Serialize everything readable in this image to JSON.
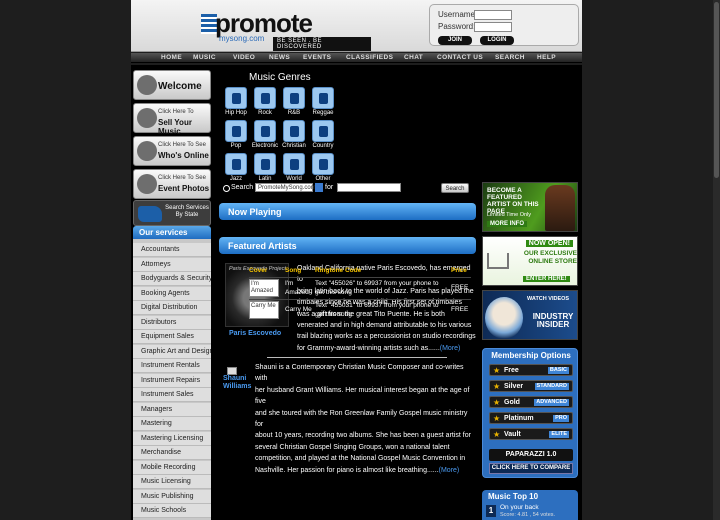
{
  "header": {
    "logo_word": "promote",
    "logo_sub": "mysong.com",
    "logo_tag": "BE SEEN . BE DISCOVERED",
    "username_label": "Username:",
    "password_label": "Password:",
    "join": "JOIN",
    "login": "LOGIN"
  },
  "nav": [
    "HOME",
    "MUSIC",
    "VIDEO",
    "NEWS",
    "EVENTS",
    "CLASSIFIEDS",
    "CHAT",
    "CONTACT US",
    "SEARCH",
    "HELP"
  ],
  "left": {
    "buttons": [
      {
        "t1": "",
        "t2": "Welcome"
      },
      {
        "t1": "Click Here To",
        "t2": "Sell Your Music"
      },
      {
        "t1": "Click Here To See",
        "t2": "Who's Online"
      },
      {
        "t1": "Click Here To See",
        "t2": "Event Photos"
      }
    ],
    "state_search": "Search Services By State",
    "services_title": "Our services",
    "services": [
      "Accountants",
      "Attorneys",
      "Bodyguards & Security",
      "Booking Agents",
      "Digital Distribution",
      "Distributors",
      "Equipment Sales",
      "Graphic Art and Design",
      "Instrument Rentals",
      "Instrument Repairs",
      "Instrument Sales",
      "Managers",
      "Mastering",
      "Mastering Licensing",
      "Merchandise",
      "Mobile Recording",
      "Music Licensing",
      "Music Publishing",
      "Music Schools"
    ]
  },
  "genres": {
    "title": "Music Genres",
    "items": [
      "Hip Hop",
      "Rock",
      "R&B",
      "Reggae",
      "Pop",
      "Electronic",
      "Christian",
      "Country",
      "Jazz",
      "Latin",
      "World",
      "Other"
    ]
  },
  "search": {
    "label": "Search",
    "select": "PromoteMySong.com",
    "for": "for",
    "button": "Search"
  },
  "now_playing": "Now Playing",
  "featured": {
    "title": "Featured Artists",
    "a1_photo_caption": "Paris Escovedo Project",
    "a1_name": "Paris Escovedo",
    "a1_bio": [
      "Oakland California native Paris Escovedo, has emerged to",
      "bring latin back to the world of Jazz. Paris has played the",
      "timbales since he was a child. His first set of timbales",
      "was a gift from the great Tito Puente. He is both",
      "venerated and in high demand attributable to his various",
      "trail blazing works as a percussionist on studio recordings",
      "for Grammy-award-winning artists such as......"
    ],
    "a2_name": "Shauni Williams",
    "a2_bio": [
      "Shauni is a Contemporary Christian Music Composer and co-writes with",
      "her husband Grant Williams. Her musical interest began at the age of five",
      "and she toured with the Ron Greenlaw Family Gospel music ministry for",
      "about 10 years, recording two albums. She has been a guest artist for",
      "several Christian Gospel Singing Groups, won a national talent",
      "competition, and played at the National Gospel Music Convention in",
      "Nashville. Her passion for piano is almost like breathing......"
    ],
    "more": "(More)",
    "table": {
      "headers": [
        "Cover",
        "Song",
        "Ringtone Code",
        "Price"
      ],
      "rows": [
        {
          "cover": "I'm Amazed",
          "song": "I'm Amazed",
          "code": "Text \"455026\" to 69937 from your phone to get this song",
          "price": "FREE"
        },
        {
          "cover": "Carry Me",
          "song": "Carry Me",
          "code": "Text \"455031\" to 69937 from your phone to get this song",
          "price": "FREE"
        }
      ]
    }
  },
  "ads": {
    "a1": [
      "BECOME A FEATURED ARTIST ON THIS PAGE",
      "Limited Time Only",
      "MORE INFO"
    ],
    "a2": [
      "NOW OPEN!",
      "OUR EXCLUSIVE ONLINE STORE",
      "ENTER HERE!"
    ],
    "a3": [
      "WATCH VIDEOS",
      "INDUSTRY INSIDER"
    ]
  },
  "membership": {
    "title": "Membership Options",
    "rows": [
      {
        "n": "Free",
        "tag": "BASIC"
      },
      {
        "n": "Silver",
        "tag": "STANDARD"
      },
      {
        "n": "Gold",
        "tag": "ADVANCED"
      },
      {
        "n": "Platinum",
        "tag": "PRO"
      },
      {
        "n": "Vault",
        "tag": "ELITE"
      }
    ],
    "paparazzi": "PAPARAZZI 1.0",
    "click": "CLICK HERE TO COMPARE"
  },
  "top10": {
    "title": "Music Top 10",
    "num": "1",
    "song": "On your back",
    "score": "Score: 4.81 , 54 votes."
  }
}
